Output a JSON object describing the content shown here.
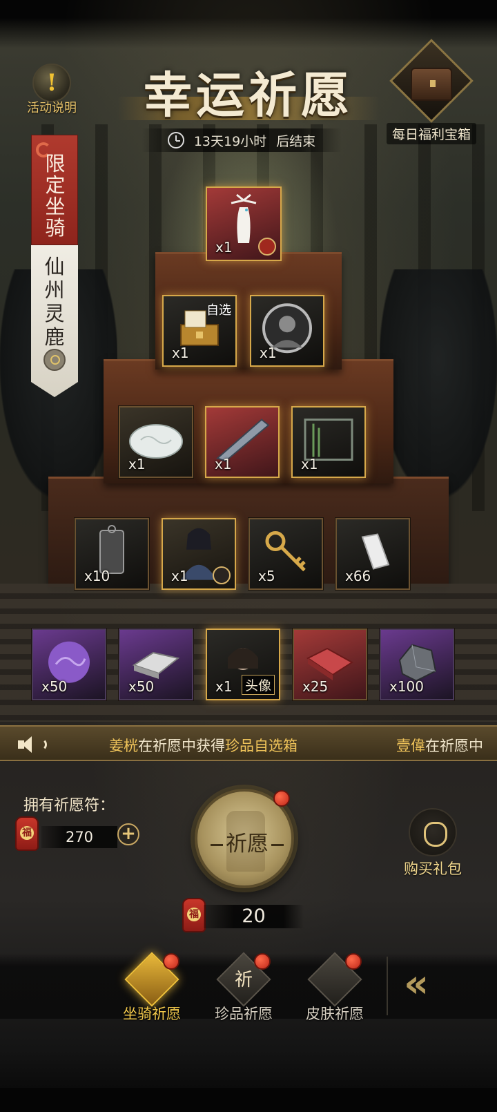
{
  "header": {
    "title": "幸运祈愿",
    "countdown": "13天19小时",
    "countdown_suffix": "后结束",
    "help_label": "活动说明",
    "chest_label": "每日福利宝箱"
  },
  "banner": {
    "top_text": "限定坐骑",
    "bottom_text": "仙州灵鹿"
  },
  "prizes": {
    "top": [
      {
        "name": "deer-mount",
        "qty": "x1"
      }
    ],
    "row2": [
      {
        "name": "select-chest",
        "qty": "x1",
        "tag": "自选"
      },
      {
        "name": "portrait-frame",
        "qty": "x1"
      }
    ],
    "row3": [
      {
        "name": "jade-stone",
        "qty": "x1"
      },
      {
        "name": "crystal-shard",
        "qty": "x1"
      },
      {
        "name": "bamboo-frame",
        "qty": "x1"
      }
    ],
    "row4": [
      {
        "name": "token-plaque",
        "qty": "x10"
      },
      {
        "name": "skin-character",
        "qty": "x1"
      },
      {
        "name": "golden-key",
        "qty": "x5"
      },
      {
        "name": "silk-spool",
        "qty": "x66"
      }
    ],
    "row5": [
      {
        "name": "purple-orb",
        "qty": "x50"
      },
      {
        "name": "silver-ingot",
        "qty": "x50"
      },
      {
        "name": "avatar",
        "qty": "x1",
        "avatar_tag": "头像"
      },
      {
        "name": "red-brick",
        "qty": "x25"
      },
      {
        "name": "iron-ore",
        "qty": "x100"
      }
    ]
  },
  "ticker": {
    "msg1_name": "姜桄",
    "msg1_mid": "在祈愿中获得",
    "msg1_item": "珍品自选箱",
    "msg2_name": "壹偉",
    "msg2_mid": "在祈愿中"
  },
  "wallet": {
    "label": "拥有祈愿符：",
    "owned": "270",
    "plus": "+",
    "token_glyph": "福"
  },
  "pray": {
    "label": "祈愿",
    "cost": "20"
  },
  "gift": {
    "label": "购买礼包"
  },
  "nav": {
    "items": [
      {
        "label": "坐骑祈愿",
        "glyph": "",
        "active": true
      },
      {
        "label": "珍品祈愿",
        "glyph": "祈",
        "active": false
      },
      {
        "label": "皮肤祈愿",
        "glyph": "",
        "active": false
      }
    ],
    "collapse": "«"
  },
  "colors": {
    "accent_gold": "#f2c94c",
    "banner_red": "#b03a2e",
    "badge_red": "#c0281a"
  }
}
